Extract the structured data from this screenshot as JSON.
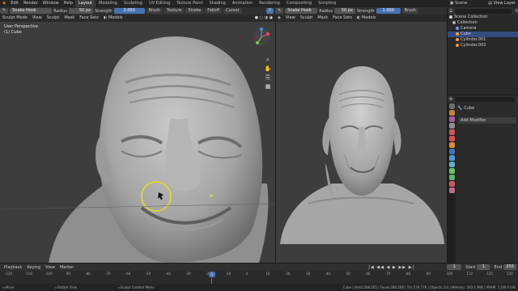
{
  "menu": [
    "Edit",
    "Render",
    "Window",
    "Help"
  ],
  "workspaces": [
    "Layout",
    "Modeling",
    "Sculpting",
    "UV Editing",
    "Texture Paint",
    "Shading",
    "Animation",
    "Rendering",
    "Compositing",
    "Scripting"
  ],
  "scene_label": "Scene",
  "view_layer_label": "View Layer",
  "left_tool": {
    "brush": "Snake Hook",
    "radius_label": "Radius",
    "radius_value": "50 px",
    "strength_label": "Strength",
    "strength_value": "2.000",
    "brush_menu": "Brush",
    "texture_menu": "Texture",
    "stroke_menu": "Stroke",
    "falloff_menu": "Falloff",
    "cursor_menu": "Cursor"
  },
  "right_tool": {
    "brush": "Snake Hook",
    "radius_label": "Radius",
    "radius_value": "50 px",
    "strength_label": "Strength",
    "strength_value": "1.000",
    "brush_menu": "Brush"
  },
  "left_header": {
    "mode": "Sculpt Mode",
    "items": [
      "View",
      "Sculpt",
      "Mask",
      "Face Sets"
    ],
    "shading": "Models"
  },
  "right_header": {
    "items": [
      "View",
      "Sculpt",
      "Mask",
      "Face Sets"
    ],
    "shading": "Models"
  },
  "viewport_info": {
    "line1": "User Perspective",
    "line2": "(1) Cube"
  },
  "outliner": {
    "title": "Scene Collection",
    "rows": [
      {
        "label": "Collection",
        "color": "#b0b0b0",
        "indent": 1,
        "selected": false
      },
      {
        "label": "Camera",
        "color": "#6a9cff",
        "indent": 2,
        "selected": false
      },
      {
        "label": "Cube",
        "color": "#ff9a3c",
        "indent": 2,
        "selected": true
      },
      {
        "label": "Cylinder.001",
        "color": "#ff9a3c",
        "indent": 2,
        "selected": false
      },
      {
        "label": "Cylinder.002",
        "color": "#ff9a3c",
        "indent": 2,
        "selected": false
      }
    ]
  },
  "properties": {
    "object": "Cube",
    "add_modifier": "Add Modifier"
  },
  "timeline": {
    "menus": [
      "Playback",
      "Keying",
      "View",
      "Marker"
    ],
    "ticks": [
      "-120",
      "-110",
      "-100",
      "-90",
      "-80",
      "-70",
      "-60",
      "-50",
      "-40",
      "-30",
      "-20",
      "-10",
      "0",
      "10",
      "20",
      "30",
      "40",
      "50",
      "60",
      "70",
      "80",
      "90",
      "100",
      "110",
      "120",
      "130"
    ],
    "current_frame": "1",
    "start_label": "Start",
    "start": "1",
    "end_label": "End",
    "end": "250"
  },
  "status": {
    "select": "Move",
    "rotate": "Rotate View",
    "context": "Sculpt Context Menu",
    "stats": "Cube | Verts:288,265 | Faces:288,268 | Tris:576,776 | Objects:1/4 | Memory: 283.1 MiB | VRAM: 1.5/8.0 GiB"
  },
  "colors": {
    "accent": "#4772b3",
    "selected_row": "#334d80",
    "brush_ring": "#e0e020",
    "frame_marker": "#4772b3"
  }
}
